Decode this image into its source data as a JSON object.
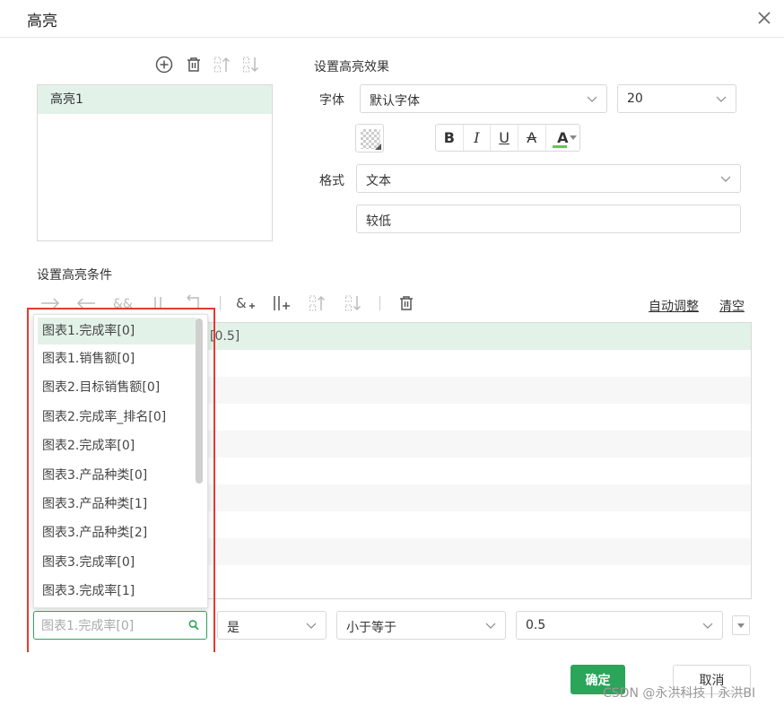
{
  "dialog": {
    "title": "高亮"
  },
  "highlight_list": {
    "items": [
      "高亮1"
    ]
  },
  "effect": {
    "section_title": "设置高亮效果",
    "font_label": "字体",
    "font_value": "默认字体",
    "size_value": "20",
    "format_buttons": {
      "bold": "B",
      "italic": "I",
      "underline": "U",
      "strike": "A",
      "color": "A"
    },
    "font_color": "#6ac259",
    "format_label": "格式",
    "format_value": "文本",
    "text_value": "较低"
  },
  "conditions": {
    "section_title": "设置高亮条件",
    "toolbar_links": {
      "auto_adjust": "自动调整",
      "clear": "清空"
    },
    "first_row_text": "[0.5]",
    "dropdown_options": [
      "图表1.完成率[0]",
      "图表1.销售额[0]",
      "图表2.目标销售额[0]",
      "图表2.完成率_排名[0]",
      "图表2.完成率[0]",
      "图表3.产品种类[0]",
      "图表3.产品种类[1]",
      "图表3.产品种类[2]",
      "图表3.完成率[0]",
      "图表3.完成率[1]"
    ],
    "field_search_placeholder": "图表1.完成率[0]",
    "is_value": "是",
    "operator_value": "小于等于",
    "compare_value": "0.5"
  },
  "footer": {
    "ok": "确定",
    "cancel": "取消"
  },
  "watermark": "CSDN @永洪科技丨永洪BI",
  "colors": {
    "accent": "#2aa55a",
    "selected_row": "#e3f2e8",
    "highlight_frame": "#e53935"
  }
}
